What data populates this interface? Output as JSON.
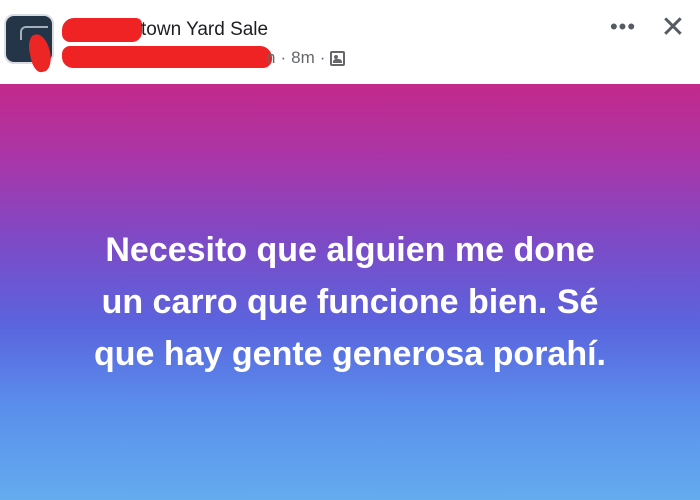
{
  "post": {
    "group_name": "town Yard Sale",
    "meta": {
      "suffix_fragment": "n",
      "separator": "·",
      "time": "8m",
      "audience_icon": "audience-icon"
    },
    "actions": {
      "more_label": "•••",
      "close_label": "✕"
    },
    "body_text": "Necesito que alguien me done\nun carro que funcione bien. Sé\nque hay gente generosa porahí.",
    "colors": {
      "gradient_top": "#c3298b",
      "gradient_middle": "#7d4ac7",
      "gradient_bottom": "#64acee",
      "redaction": "#ef2323"
    }
  }
}
